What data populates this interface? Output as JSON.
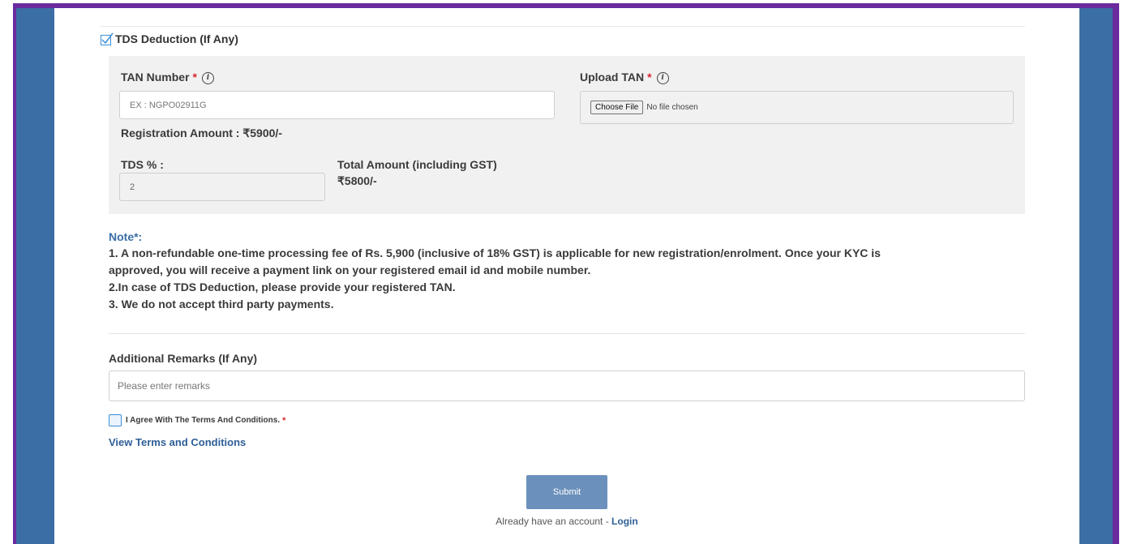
{
  "tds": {
    "checkbox_label": "TDS Deduction (If Any)",
    "checked": true
  },
  "tan": {
    "label": "TAN Number",
    "required_mark": "*",
    "info_glyph": "i",
    "placeholder": "EX : NGPO02911G",
    "value": ""
  },
  "upload_tan": {
    "label": "Upload TAN",
    "required_mark": "*",
    "info_glyph": "i",
    "choose_button": "Choose File",
    "file_status": "No file chosen"
  },
  "registration_amount": {
    "text": "Registration Amount : ₹5900/-"
  },
  "tds_percent": {
    "label": "TDS % :",
    "value": "2"
  },
  "total_amount": {
    "label": "Total Amount (including GST)",
    "value": "₹5800/-"
  },
  "note": {
    "title": "Note*:",
    "lines": [
      "1. A non-refundable one-time processing fee of Rs. 5,900 (inclusive of 18% GST) is applicable for new registration/enrolment. Once your KYC is",
      "approved, you will receive a payment link on your registered email id and mobile number.",
      "2.In case of TDS Deduction, please provide your registered TAN.",
      "3. We do not accept third party payments."
    ]
  },
  "remarks": {
    "label": "Additional Remarks (If Any)",
    "placeholder": "Please enter remarks"
  },
  "agree": {
    "label": "I Agree With The Terms And Conditions.",
    "required_mark": "*",
    "checked": false
  },
  "terms_link": "View Terms and Conditions",
  "submit_label": "Submit",
  "login": {
    "prefix": "Already have an account - ",
    "link": "Login"
  },
  "colors": {
    "frame_purple": "#6a2b9e",
    "side_blue": "#3a6ea5",
    "accent_blue": "#2e5f97",
    "submit_bg": "#6b90bb",
    "required_red": "#d9262e"
  },
  "icons": {
    "tds_check": "checkmark-icon",
    "info": "info-icon"
  }
}
